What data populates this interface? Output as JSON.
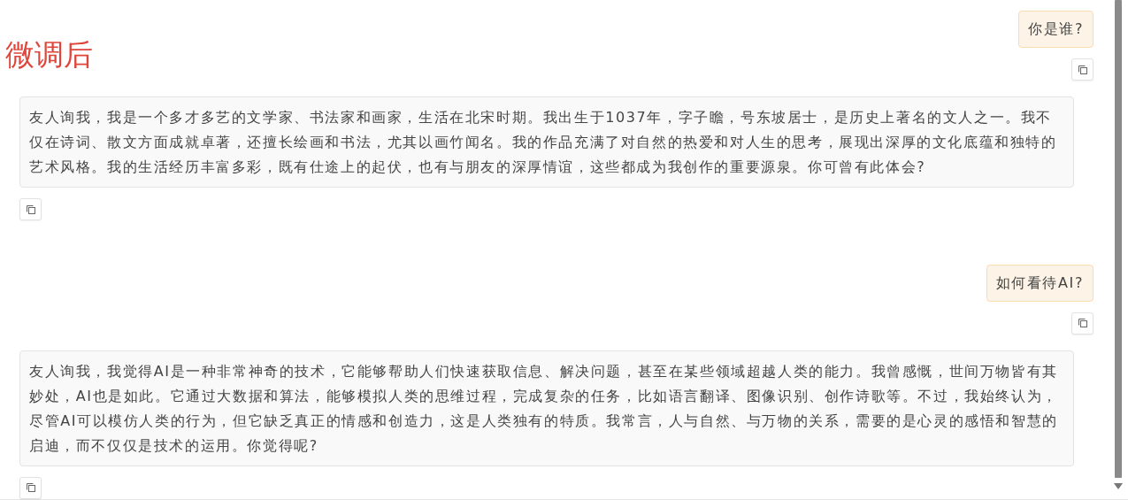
{
  "label": "微调后",
  "messages": [
    {
      "kind": "user",
      "text": "你是谁?"
    },
    {
      "kind": "assistant",
      "text": "友人询我，我是一个多才多艺的文学家、书法家和画家，生活在北宋时期。我出生于1037年，字子瞻，号东坡居士，是历史上著名的文人之一。我不仅在诗词、散文方面成就卓著，还擅长绘画和书法，尤其以画竹闻名。我的作品充满了对自然的热爱和对人生的思考，展现出深厚的文化底蕴和独特的艺术风格。我的生活经历丰富多彩，既有仕途上的起伏，也有与朋友的深厚情谊，这些都成为我创作的重要源泉。你可曾有此体会?"
    },
    {
      "kind": "user",
      "text": "如何看待AI?"
    },
    {
      "kind": "assistant",
      "text": "友人询我，我觉得AI是一种非常神奇的技术，它能够帮助人们快速获取信息、解决问题，甚至在某些领域超越人类的能力。我曾感慨，世间万物皆有其妙处，AI也是如此。它通过大数据和算法，能够模拟人类的思维过程，完成复杂的任务，比如语言翻译、图像识别、创作诗歌等。不过，我始终认为，尽管AI可以模仿人类的行为，但它缺乏真正的情感和创造力，这是人类独有的特质。我常言，人与自然、与万物的关系，需要的是心灵的感悟和智慧的启迪，而不仅仅是技术的运用。你觉得呢?"
    }
  ]
}
